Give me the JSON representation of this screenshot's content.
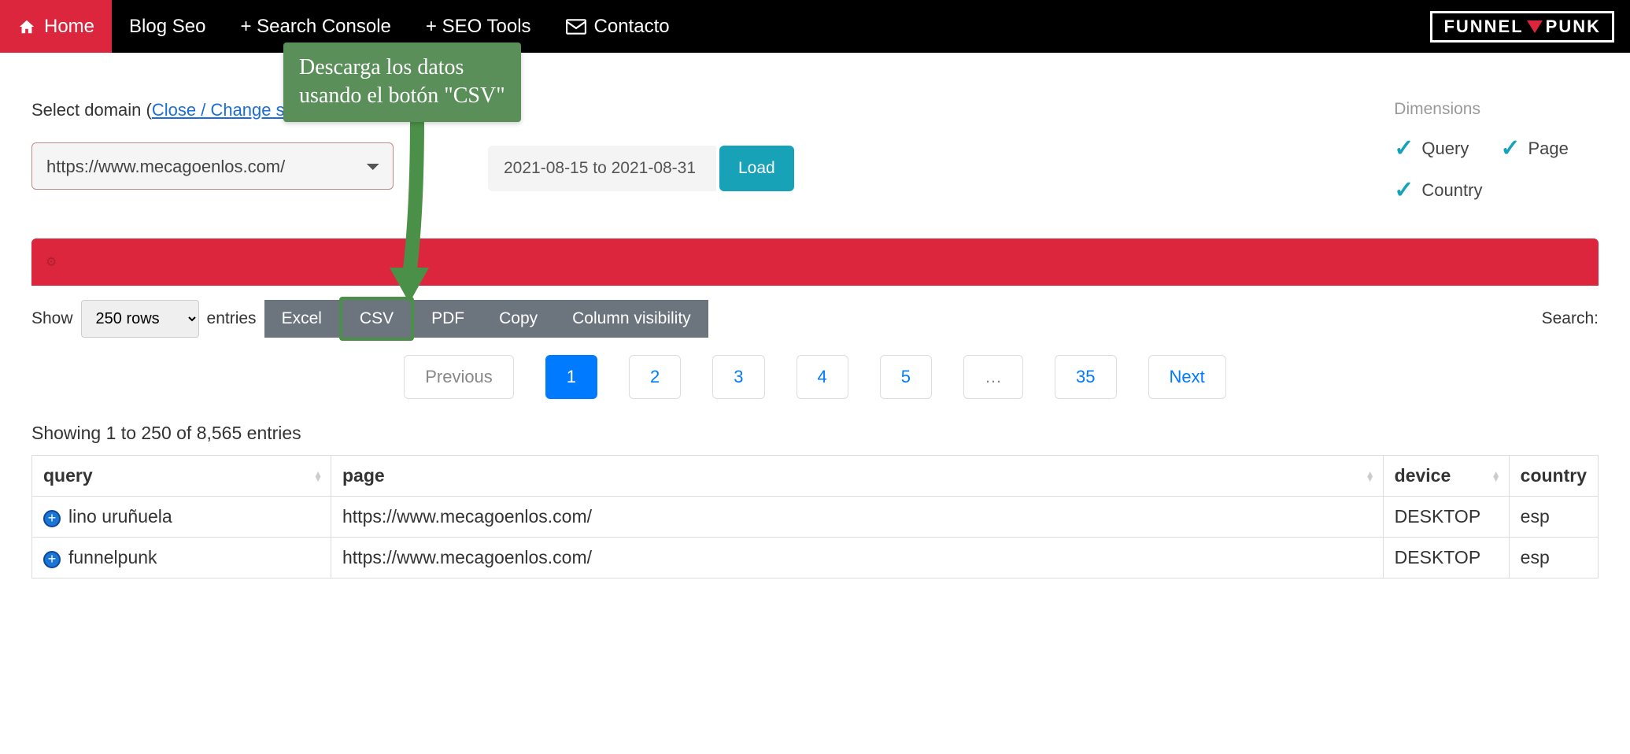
{
  "nav": {
    "home": "Home",
    "blog": "Blog Seo",
    "search_console": "+ Search Console",
    "seo_tools": "+ SEO Tools",
    "contacto": "Contacto",
    "logo_a": "FUNNEL",
    "logo_b": "PUNK"
  },
  "callout": {
    "line1": "Descarga los datos",
    "line2": "usando el botón \"CSV\""
  },
  "select_domain": {
    "label_a": "Select domain (",
    "link": "Close / Change sessio",
    "value": "https://www.mecagoenlos.com/"
  },
  "date": {
    "value": "2021-08-15 to 2021-08-31",
    "load": "Load"
  },
  "dims": {
    "title": "Dimensions",
    "query": "Query",
    "page": "Page",
    "country": "Country"
  },
  "table": {
    "show": "Show",
    "rows": "250 rows",
    "entries": "entries",
    "buttons": {
      "excel": "Excel",
      "csv": "CSV",
      "pdf": "PDF",
      "copy": "Copy",
      "colvis": "Column visibility"
    },
    "search": "Search:",
    "pager": {
      "prev": "Previous",
      "p1": "1",
      "p2": "2",
      "p3": "3",
      "p4": "4",
      "p5": "5",
      "dots": "…",
      "p35": "35",
      "next": "Next"
    },
    "showing": "Showing 1 to 250 of 8,565 entries",
    "cols": {
      "query": "query",
      "page": "page",
      "device": "device",
      "country": "country"
    },
    "rows_data": [
      {
        "query": "lino uruñuela",
        "page": "https://www.mecagoenlos.com/",
        "device": "DESKTOP",
        "country": "esp"
      },
      {
        "query": "funnelpunk",
        "page": "https://www.mecagoenlos.com/",
        "device": "DESKTOP",
        "country": "esp"
      }
    ]
  }
}
